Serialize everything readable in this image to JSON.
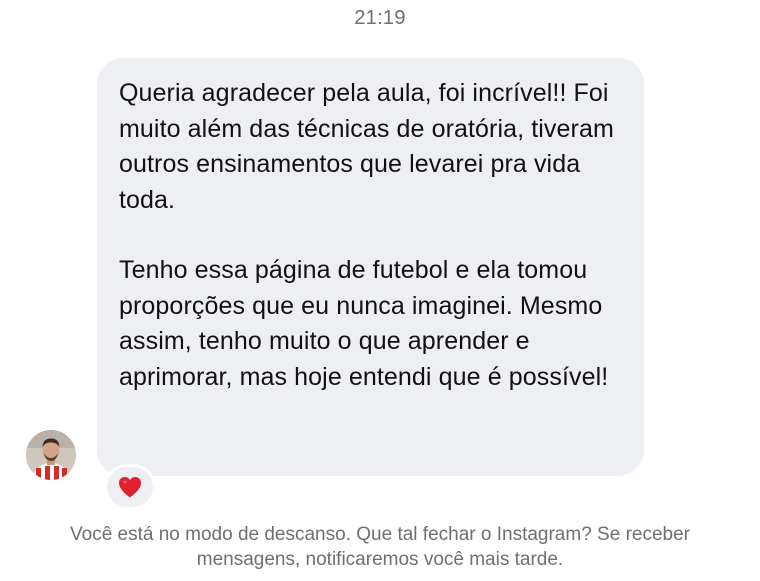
{
  "thread": {
    "timestamp": "21:19"
  },
  "message": {
    "paragraphs": [
      "Queria agradecer pela aula, foi incrível!! Foi muito além das técnicas de oratória, tiveram outros ensinamentos que levarei pra vida toda.",
      "Tenho essa página de futebol e ela tomou proporções que eu nunca imaginei. Mesmo assim, tenho muito o que aprender e aprimorar, mas hoje entendi que é possível!"
    ],
    "reaction_icon": "red-heart-icon"
  },
  "sender": {
    "avatar_icon": "profile-photo"
  },
  "quiet_mode": {
    "notice": "Você está no modo de descanso. Que tal fechar o Instagram? Se receber mensagens, notificaremos você mais tarde."
  },
  "colors": {
    "bubble": "#eeeff2",
    "text": "#111111",
    "muted": "#6f6f74",
    "heart": "#e0202c"
  }
}
